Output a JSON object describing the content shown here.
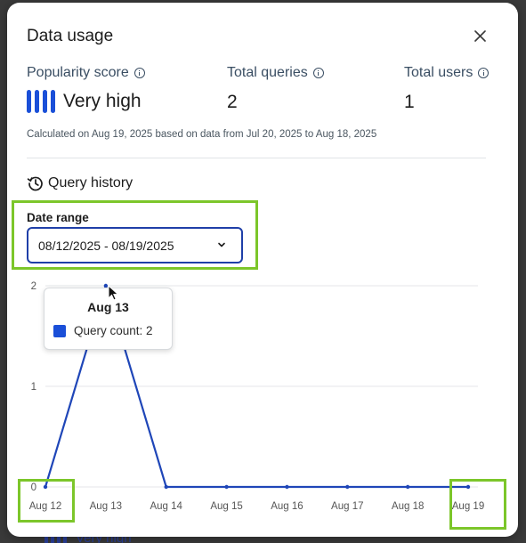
{
  "modal": {
    "title": "Data usage",
    "close_icon": "close-icon"
  },
  "stats": {
    "popularity": {
      "label": "Popularity score",
      "value": "Very high",
      "level_bars": 4
    },
    "total_queries": {
      "label": "Total queries",
      "value": "2"
    },
    "total_users": {
      "label": "Total users",
      "value": "1"
    }
  },
  "calc_note": "Calculated on Aug 19, 2025 based on data from Jul 20, 2025 to Aug 18, 2025",
  "query_history": {
    "title": "Query history",
    "icon": "history-icon",
    "date_range_label": "Date range",
    "date_range_value": "08/12/2025 - 08/19/2025"
  },
  "tooltip": {
    "title": "Aug 13",
    "series_label": "Query count: 2"
  },
  "colors": {
    "accent": "#1a4fd8",
    "line": "#1f46b8",
    "highlight": "#7cc62a"
  },
  "chart_data": {
    "type": "line",
    "categories": [
      "Aug 12",
      "Aug 13",
      "Aug 14",
      "Aug 15",
      "Aug 16",
      "Aug 17",
      "Aug 18",
      "Aug 19"
    ],
    "series": [
      {
        "name": "Query count",
        "values": [
          0,
          2,
          0,
          0,
          0,
          0,
          0,
          0
        ]
      }
    ],
    "yticks": [
      "0",
      "1",
      "2"
    ],
    "ylim": [
      0,
      2
    ],
    "grid": true
  },
  "backdrop": {
    "text": "Very high"
  }
}
